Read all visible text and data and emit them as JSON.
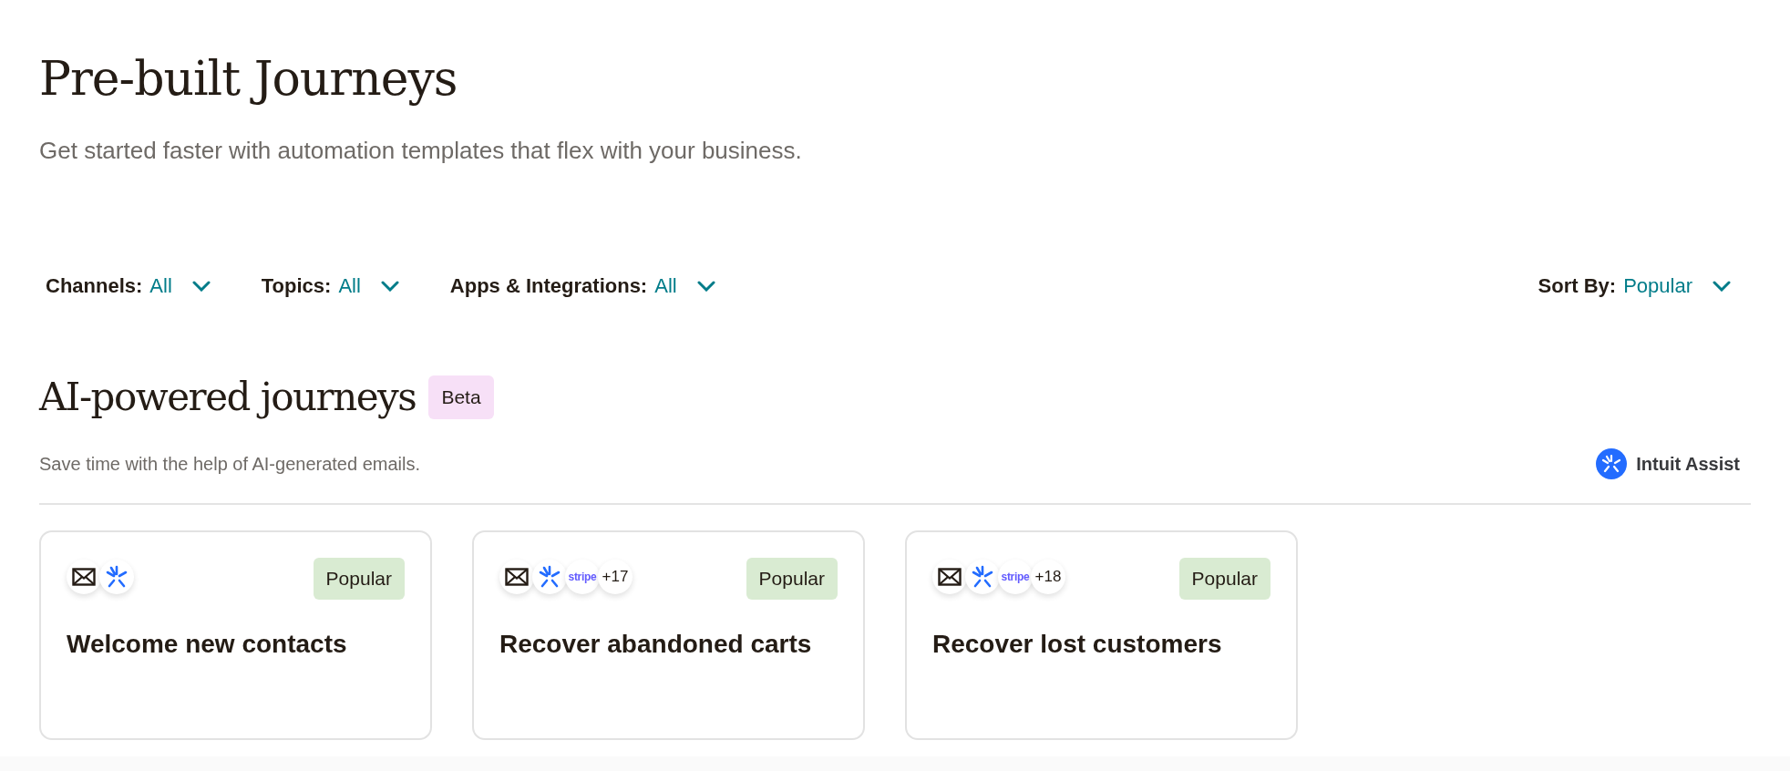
{
  "page": {
    "title": "Pre-built Journeys",
    "subtitle": "Get started faster with automation templates that flex with your business."
  },
  "filters": [
    {
      "label": "Channels:",
      "value": "All"
    },
    {
      "label": "Topics:",
      "value": "All"
    },
    {
      "label": "Apps & Integrations:",
      "value": "All"
    }
  ],
  "sort": {
    "label": "Sort By:",
    "value": "Popular"
  },
  "section": {
    "title": "AI-powered journeys",
    "badge": "Beta",
    "description": "Save time with the help of AI-generated emails.",
    "assist_label": "Intuit Assist"
  },
  "cards": [
    {
      "title": "Welcome new contacts",
      "tag": "Popular",
      "integrations": [
        {
          "kind": "email"
        },
        {
          "kind": "assist"
        }
      ]
    },
    {
      "title": "Recover abandoned carts",
      "tag": "Popular",
      "integrations": [
        {
          "kind": "email"
        },
        {
          "kind": "assist"
        },
        {
          "kind": "stripe",
          "label": "stripe"
        },
        {
          "kind": "more",
          "label": "+17"
        }
      ]
    },
    {
      "title": "Recover lost customers",
      "tag": "Popular",
      "integrations": [
        {
          "kind": "email"
        },
        {
          "kind": "assist"
        },
        {
          "kind": "stripe",
          "label": "stripe"
        },
        {
          "kind": "more",
          "label": "+18"
        }
      ]
    }
  ]
}
